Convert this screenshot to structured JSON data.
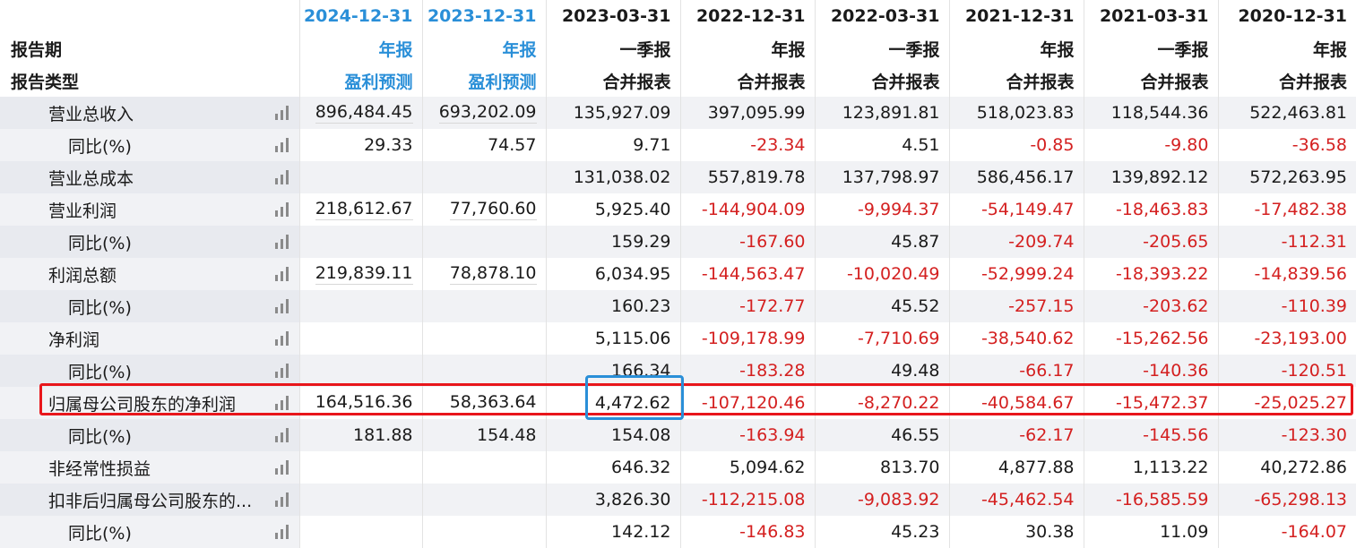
{
  "header": {
    "period_label": "报告期",
    "type_label": "报告类型",
    "columns": [
      {
        "date": "2024-12-31",
        "period": "年报",
        "type": "盈利预测",
        "forecast": true
      },
      {
        "date": "2023-12-31",
        "period": "年报",
        "type": "盈利预测",
        "forecast": true
      },
      {
        "date": "2023-03-31",
        "period": "一季报",
        "type": "合并报表",
        "forecast": false
      },
      {
        "date": "2022-12-31",
        "period": "年报",
        "type": "合并报表",
        "forecast": false
      },
      {
        "date": "2022-03-31",
        "period": "一季报",
        "type": "合并报表",
        "forecast": false
      },
      {
        "date": "2021-12-31",
        "period": "年报",
        "type": "合并报表",
        "forecast": false
      },
      {
        "date": "2021-03-31",
        "period": "一季报",
        "type": "合并报表",
        "forecast": false
      },
      {
        "date": "2020-12-31",
        "period": "年报",
        "type": "合并报表",
        "forecast": false
      }
    ]
  },
  "rows": [
    {
      "label": "营业总收入",
      "indent": false,
      "values": [
        "896,484.45",
        "693,202.09",
        "135,927.09",
        "397,095.99",
        "123,891.81",
        "518,023.83",
        "118,544.36",
        "522,463.81"
      ]
    },
    {
      "label": "同比(%)",
      "indent": true,
      "values": [
        "29.33",
        "74.57",
        "9.71",
        "-23.34",
        "4.51",
        "-0.85",
        "-9.80",
        "-36.58"
      ]
    },
    {
      "label": "营业总成本",
      "indent": false,
      "values": [
        "",
        "",
        "131,038.02",
        "557,819.78",
        "137,798.97",
        "586,456.17",
        "139,892.12",
        "572,263.95"
      ]
    },
    {
      "label": "营业利润",
      "indent": false,
      "values": [
        "218,612.67",
        "77,760.60",
        "5,925.40",
        "-144,904.09",
        "-9,994.37",
        "-54,149.47",
        "-18,463.83",
        "-17,482.38"
      ]
    },
    {
      "label": "同比(%)",
      "indent": true,
      "values": [
        "",
        "",
        "159.29",
        "-167.60",
        "45.87",
        "-209.74",
        "-205.65",
        "-112.31"
      ]
    },
    {
      "label": "利润总额",
      "indent": false,
      "values": [
        "219,839.11",
        "78,878.10",
        "6,034.95",
        "-144,563.47",
        "-10,020.49",
        "-52,999.24",
        "-18,393.22",
        "-14,839.56"
      ]
    },
    {
      "label": "同比(%)",
      "indent": true,
      "values": [
        "",
        "",
        "160.23",
        "-172.77",
        "45.52",
        "-257.15",
        "-203.62",
        "-110.39"
      ]
    },
    {
      "label": "净利润",
      "indent": false,
      "values": [
        "",
        "",
        "5,115.06",
        "-109,178.99",
        "-7,710.69",
        "-38,540.62",
        "-15,262.56",
        "-23,193.00"
      ]
    },
    {
      "label": "同比(%)",
      "indent": true,
      "values": [
        "",
        "",
        "166.34",
        "-183.28",
        "49.48",
        "-66.17",
        "-140.36",
        "-120.51"
      ]
    },
    {
      "label": "归属母公司股东的净利润",
      "indent": false,
      "highlight": true,
      "values": [
        "164,516.36",
        "58,363.64",
        "4,472.62",
        "-107,120.46",
        "-8,270.22",
        "-40,584.67",
        "-15,472.37",
        "-25,025.27"
      ]
    },
    {
      "label": "同比(%)",
      "indent": true,
      "values": [
        "181.88",
        "154.48",
        "154.08",
        "-163.94",
        "46.55",
        "-62.17",
        "-145.56",
        "-123.30"
      ]
    },
    {
      "label": "非经常性损益",
      "indent": false,
      "values": [
        "",
        "",
        "646.32",
        "5,094.62",
        "813.70",
        "4,877.88",
        "1,113.22",
        "40,272.86"
      ]
    },
    {
      "label": "扣非后归属母公司股东的...",
      "indent": false,
      "values": [
        "",
        "",
        "3,826.30",
        "-112,215.08",
        "-9,083.92",
        "-45,462.54",
        "-16,585.59",
        "-65,298.13"
      ]
    },
    {
      "label": "同比(%)",
      "indent": true,
      "values": [
        "",
        "",
        "142.12",
        "-146.83",
        "45.23",
        "30.38",
        "11.09",
        "-164.07"
      ]
    }
  ],
  "colors": {
    "forecast_header": "#2a8fd8",
    "negative": "#d42020",
    "highlight_row": "#e8161b",
    "highlight_cell": "#2a8fd8"
  },
  "icons": {
    "row_chart": "bar-chart-icon"
  }
}
